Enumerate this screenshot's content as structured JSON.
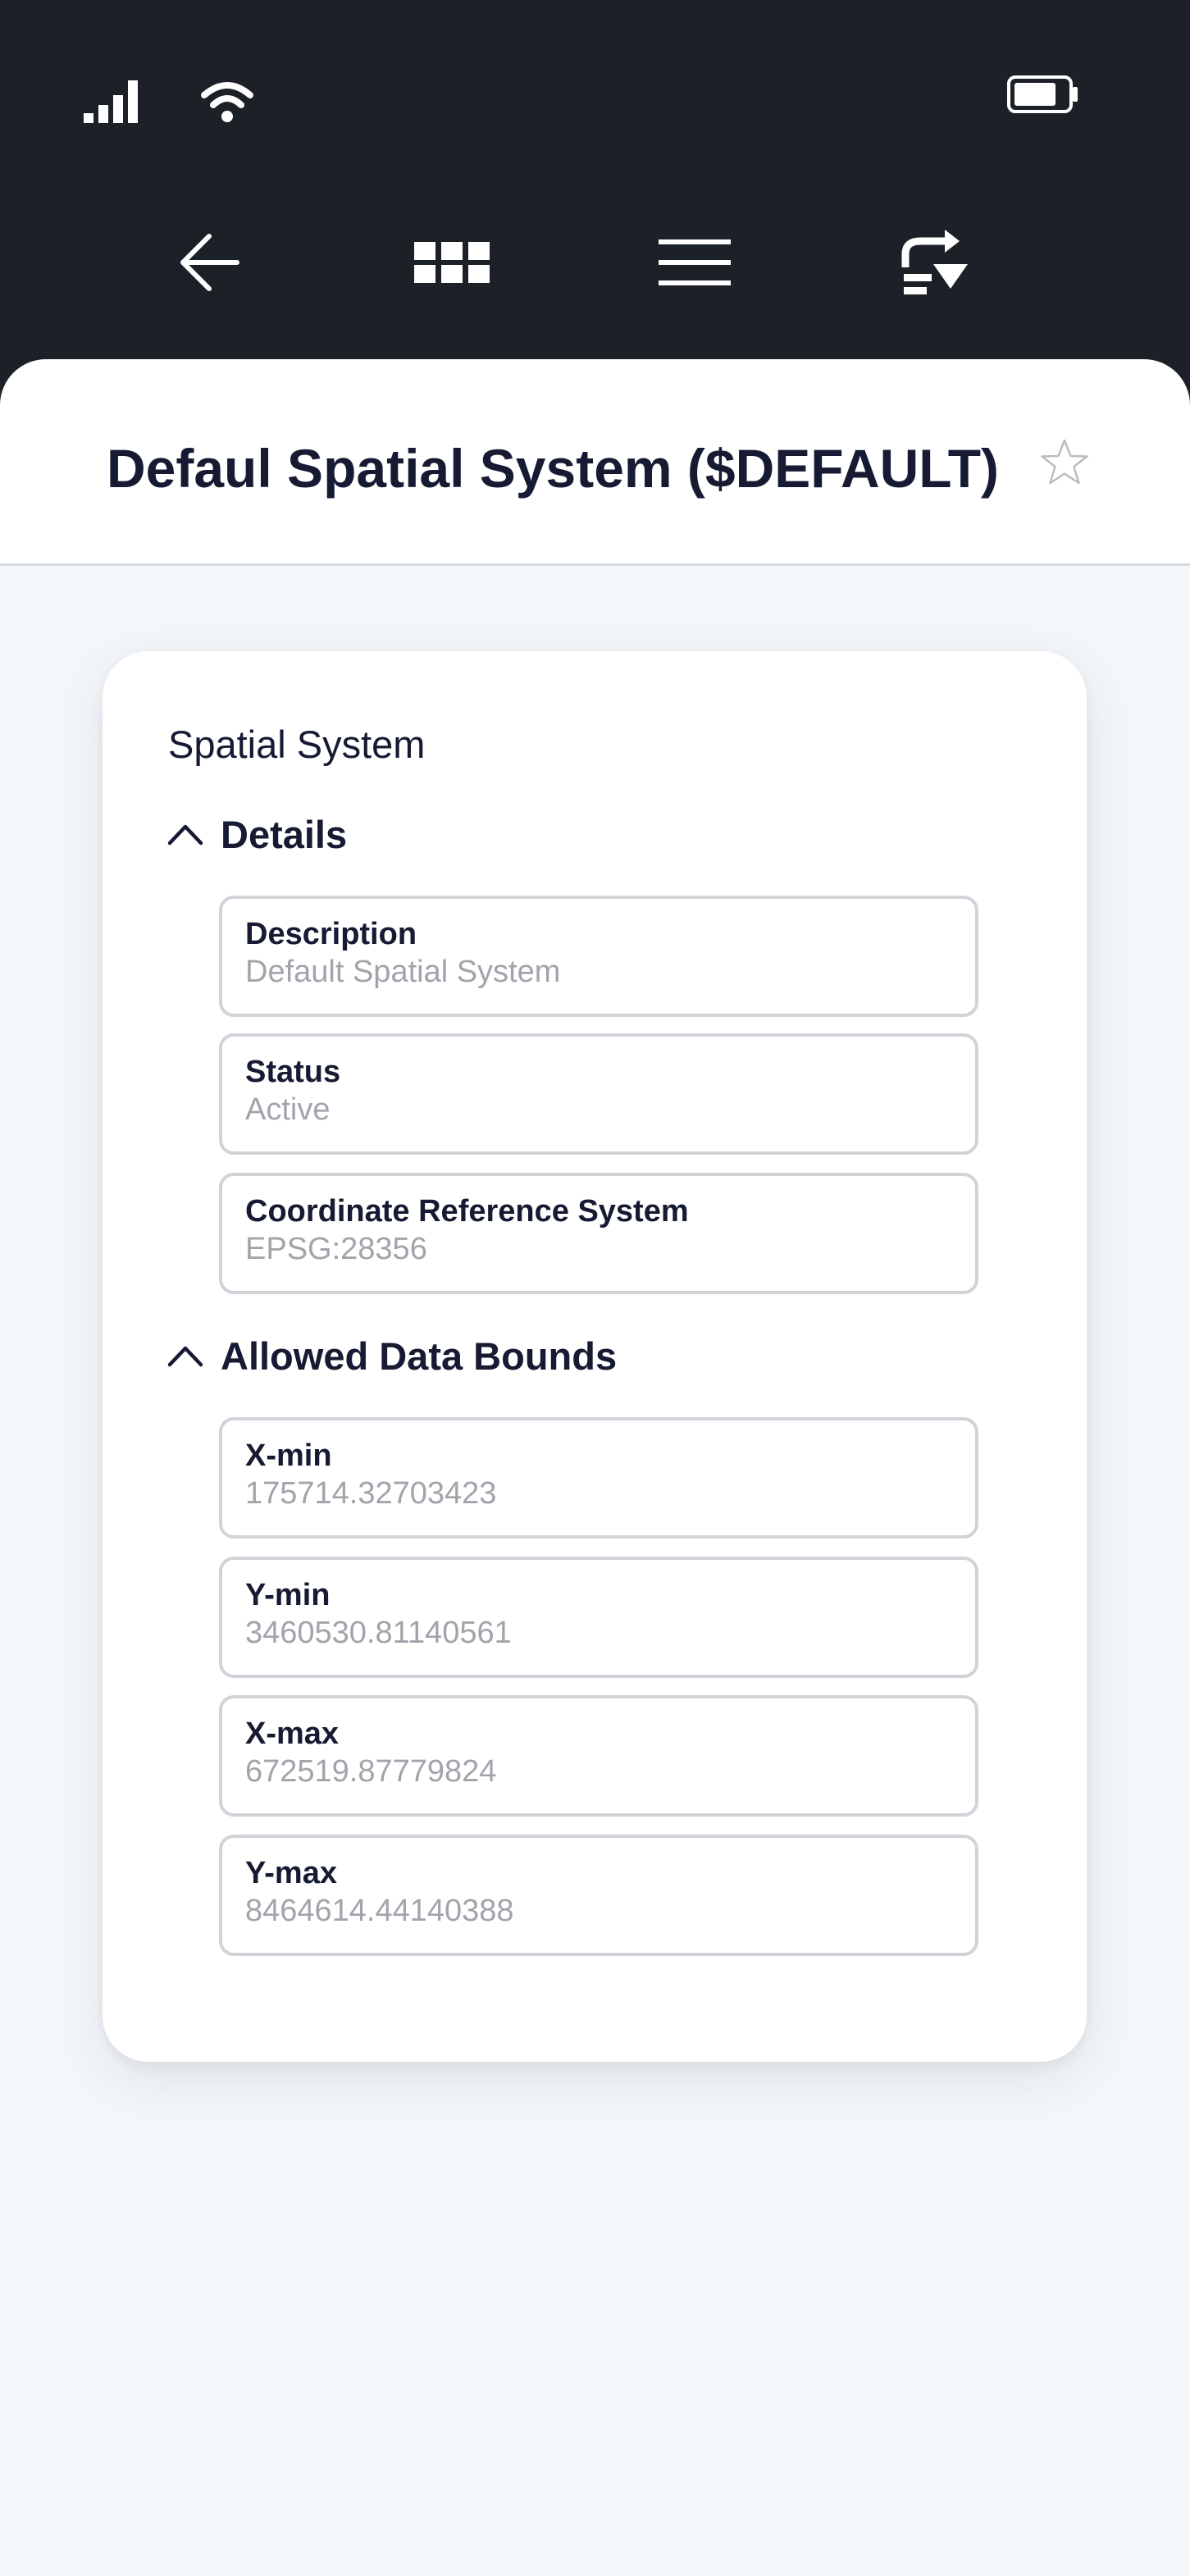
{
  "header": {
    "title": "Defaul Spatial System ($DEFAULT)"
  },
  "card": {
    "title": "Spatial System",
    "sections": [
      {
        "label": "Details",
        "fields": [
          {
            "label": "Description",
            "value": "Default Spatial System"
          },
          {
            "label": "Status",
            "value": "Active"
          },
          {
            "label": "Coordinate Reference System",
            "value": "EPSG:28356"
          }
        ]
      },
      {
        "label": "Allowed Data Bounds",
        "fields": [
          {
            "label": "X-min",
            "value": "175714.32703423"
          },
          {
            "label": "Y-min",
            "value": "3460530.81140561"
          },
          {
            "label": "X-max",
            "value": "672519.87779824"
          },
          {
            "label": "Y-max",
            "value": "8464614.44140388"
          }
        ]
      }
    ]
  },
  "icons": {
    "status": [
      "signal-icon",
      "wifi-icon",
      "battery-icon"
    ],
    "nav": [
      "back-arrow-icon",
      "apps-grid-icon",
      "menu-icon",
      "logout-icon"
    ],
    "favorite": "star-outline-icon",
    "section_toggle": "chevron-up-icon"
  },
  "colors": {
    "topbar": "#1c2128",
    "background": "#f4f7fa",
    "text_primary": "#161b33",
    "text_secondary": "#a1a4ab",
    "field_border": "#d0d3d8"
  }
}
